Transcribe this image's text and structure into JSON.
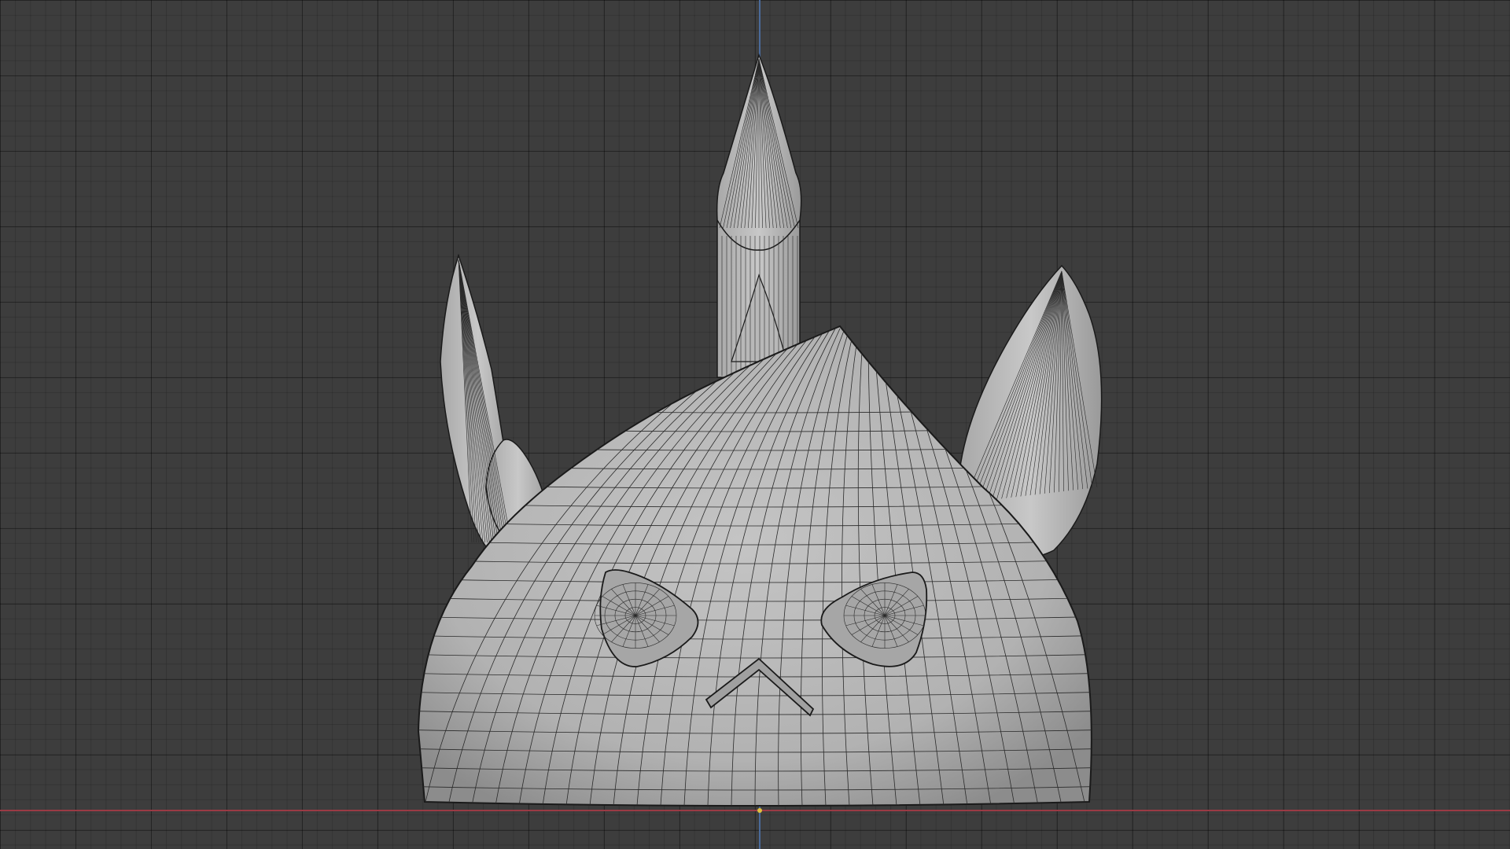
{
  "viewport": {
    "view": "front-orthographic",
    "shading": "solid-wireframe",
    "grid": true,
    "colors": {
      "background": "#3d3d3d",
      "x_axis": "#9a3a44",
      "z_axis": "#4a6a9a",
      "origin": "#e0c040",
      "mesh_fill": "#b4b4b4",
      "wire": "#1a1a1a"
    }
  },
  "model": {
    "parts": [
      "body",
      "top-cone",
      "left-horn",
      "left-small-horn",
      "right-horn",
      "back-spike",
      "left-eye",
      "right-eye",
      "mouth"
    ]
  }
}
